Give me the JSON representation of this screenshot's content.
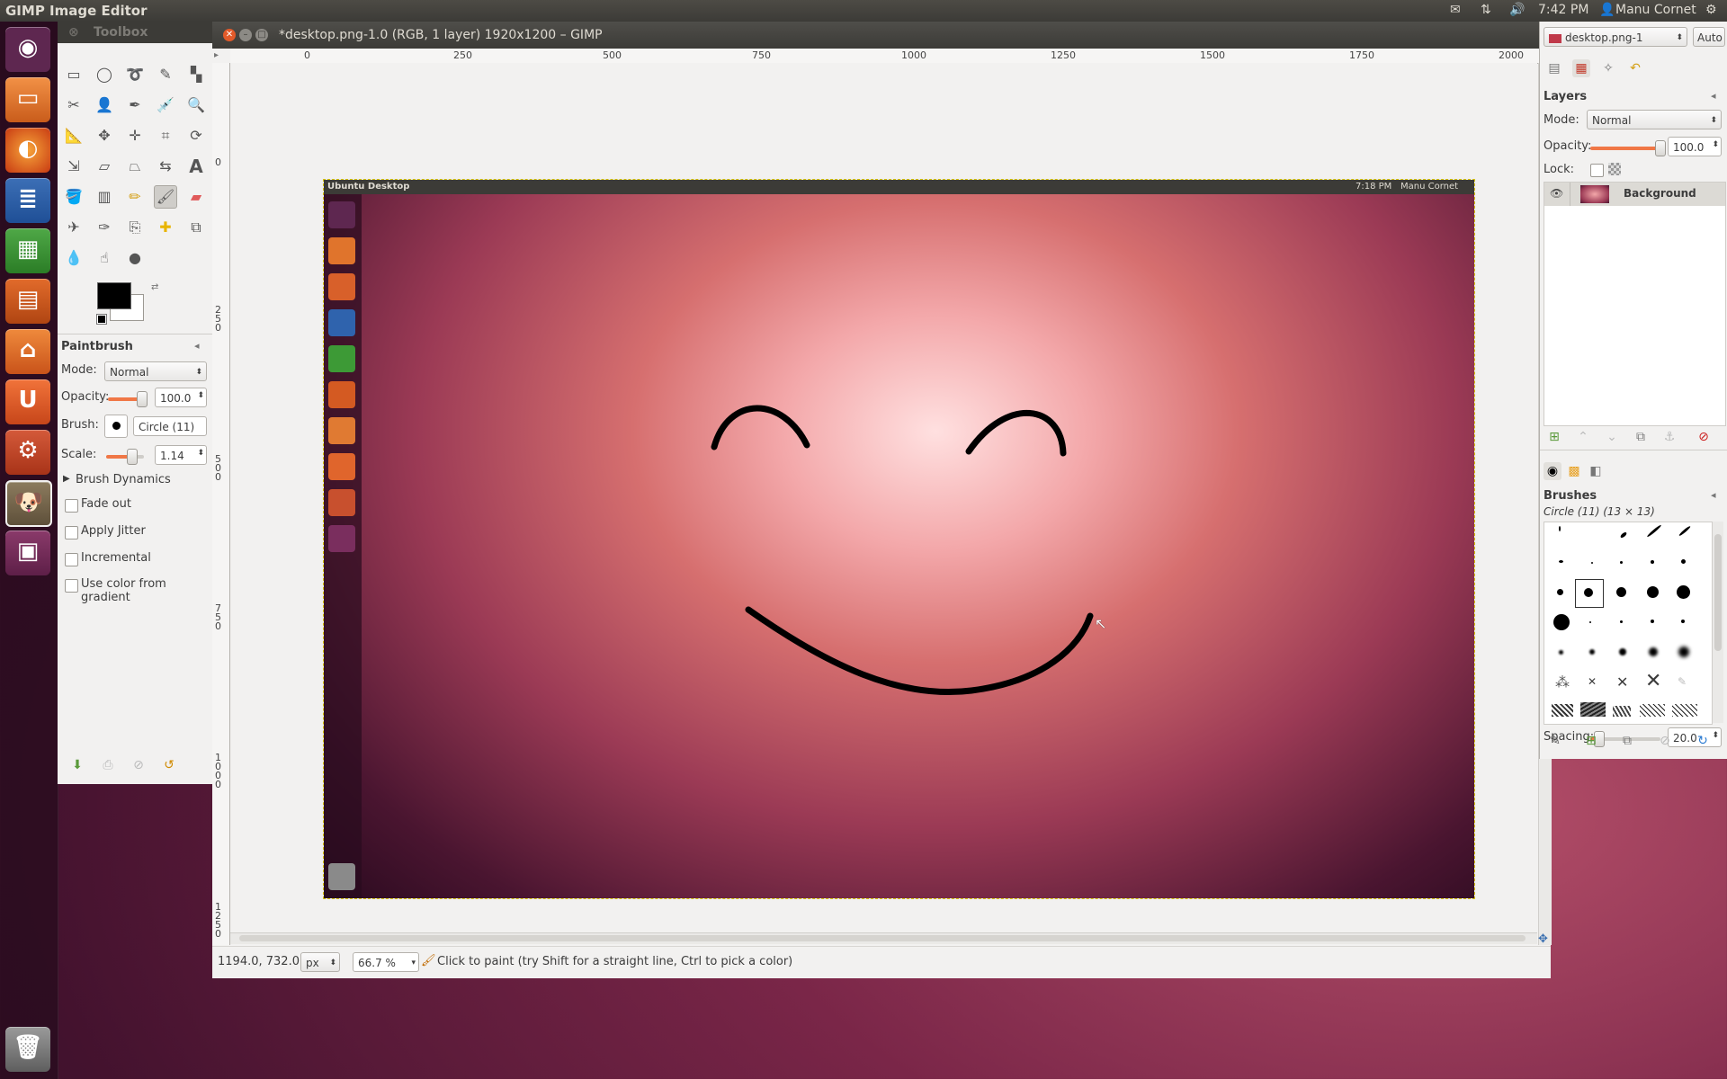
{
  "top_panel": {
    "app_title": "GIMP Image Editor",
    "time": "7:42 PM",
    "user": "Manu Cornet"
  },
  "launcher": {
    "items": [
      "Ubuntu",
      "Files",
      "Firefox",
      "LibreOffice Writer",
      "LibreOffice Calc",
      "LibreOffice Impress",
      "Software Center",
      "Ubuntu One",
      "System Settings",
      "GIMP",
      "Workspaces",
      "Trash"
    ]
  },
  "toolbox": {
    "title": "Toolbox",
    "tool_options": {
      "title": "Paintbrush",
      "mode_label": "Mode:",
      "mode_value": "Normal",
      "opacity_label": "Opacity:",
      "opacity_value": "100.0",
      "brush_label": "Brush:",
      "brush_value": "Circle (11)",
      "scale_label": "Scale:",
      "scale_value": "1.14",
      "dynamics_label": "Brush Dynamics",
      "fade_out": "Fade out",
      "apply_jitter": "Apply Jitter",
      "incremental": "Incremental",
      "use_color_gradient": "Use color from gradient"
    },
    "colors": {
      "foreground": "#000000",
      "background": "#ffffff"
    }
  },
  "image_window": {
    "title": "*desktop.png-1.0 (RGB, 1 layer) 1920x1200 – GIMP",
    "ruler_h": [
      "0",
      "250",
      "500",
      "750",
      "1000",
      "1250",
      "1500",
      "1750",
      "2000"
    ],
    "ruler_v": [
      "0",
      "250",
      "500",
      "750",
      "1000",
      "1250"
    ],
    "image": {
      "panel_title": "Ubuntu Desktop",
      "panel_time": "7:18 PM",
      "panel_user": "Manu Cornet"
    },
    "status": {
      "coords": "1194.0, 732.0",
      "unit": "px",
      "zoom": "66.7 %",
      "message": "Click to paint (try Shift for a straight line, Ctrl to pick a color)"
    }
  },
  "dock": {
    "image_selector": "desktop.png-1",
    "auto_button": "Auto",
    "layers": {
      "title": "Layers",
      "mode_label": "Mode:",
      "mode_value": "Normal",
      "opacity_label": "Opacity:",
      "opacity_value": "100.0",
      "lock_label": "Lock:",
      "layer_name": "Background"
    },
    "brushes": {
      "title": "Brushes",
      "selected": "Circle (11) (13 × 13)",
      "spacing_label": "Spacing:",
      "spacing_value": "20.0"
    }
  }
}
